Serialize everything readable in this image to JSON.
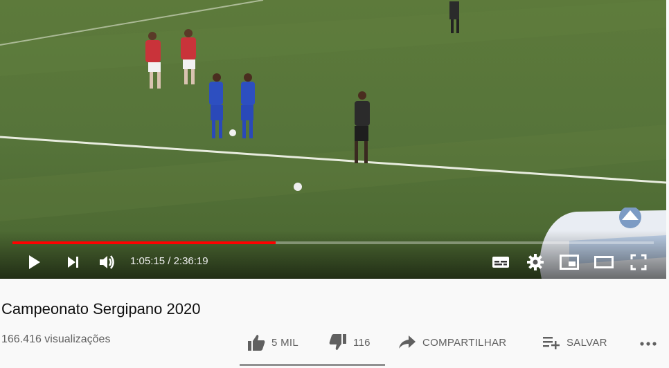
{
  "player": {
    "time_current": "1:05:15",
    "time_separator": " / ",
    "time_total": "2:36:19",
    "progress_played_fraction": 0.41,
    "progress_loaded_fraction": 0.41,
    "accent_color": "#ff0000"
  },
  "video": {
    "title": "Campeonato Sergipano 2020",
    "views": "166.416 visualizações"
  },
  "actions": {
    "like_label": "5 MIL",
    "dislike_label": "116",
    "share_label": "COMPARTILHAR",
    "save_label": "SALVAR"
  },
  "icons": {
    "play": "play-icon",
    "next": "next-icon",
    "volume": "volume-icon",
    "subtitles": "subtitles-icon",
    "settings": "gear-icon",
    "miniplayer": "miniplayer-icon",
    "theater": "theater-mode-icon",
    "fullscreen": "fullscreen-icon",
    "like": "thumbs-up-icon",
    "dislike": "thumbs-down-icon",
    "share": "share-arrow-icon",
    "save": "playlist-add-icon",
    "more": "more-horizontal-icon"
  }
}
